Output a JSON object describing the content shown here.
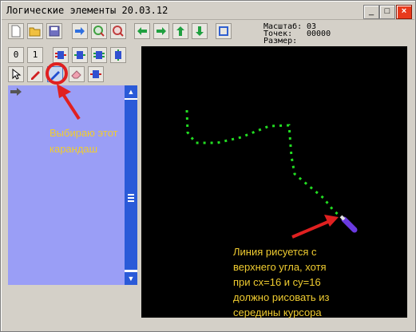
{
  "window": {
    "title": "Логические элементы 20.03.12",
    "minimize_label": "_",
    "maximize_label": "□",
    "close_label": "×"
  },
  "toolbar": {
    "row2": {
      "zero_label": "0",
      "one_label": "1"
    }
  },
  "info": {
    "scale_label": "Масштаб:",
    "scale_value": "03",
    "points_label": "Точек:",
    "points_value": "00000",
    "size_label": "Размер:",
    "size_value": ""
  },
  "annotations": {
    "pencil_note_1": "Выбираю этот",
    "pencil_note_2": "карандаш",
    "line_note_1": "Линия рисуется с",
    "line_note_2": "верхнего угла, хотя",
    "line_note_3": "при cx=16 и cy=16",
    "line_note_4": "должно рисовать из",
    "line_note_5": "середины курсора"
  },
  "colors": {
    "window_bg": "#d4d0c8",
    "panel_bg": "#9a9ef6",
    "scroll_accent": "#2a5ad8",
    "canvas_bg": "#000000",
    "line_color": "#22dd22",
    "annotation_red": "#e02020",
    "annotation_text": "#f0cc30"
  },
  "icons": [
    "new-file-icon",
    "open-folder-icon",
    "save-disk-icon",
    "arrow-right-icon",
    "zoom-in-icon",
    "zoom-out-icon",
    "arrow-left-icon",
    "arrow-right-icon",
    "arrow-up-icon",
    "arrow-down-icon",
    "fit-view-icon",
    "gate-icon",
    "gate-icon",
    "gate-icon",
    "gate-icon",
    "cursor-pointer-icon",
    "red-pencil-icon",
    "blue-pencil-icon",
    "eraser-icon",
    "gate-icon",
    "panel-arrow-icon"
  ]
}
